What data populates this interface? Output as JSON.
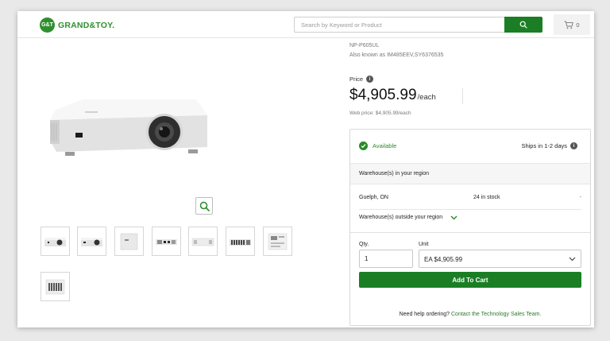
{
  "header": {
    "logo_badge": "G&T",
    "logo_text": "GRAND&TOY.",
    "search_placeholder": "Search by Keyword or Product",
    "cart_count": "0"
  },
  "product": {
    "sku": "NP-P605UL",
    "also_known": "Also known as IM485EEV,SY6376535",
    "price_label": "Price",
    "price": "$4,905.99",
    "per_unit": "/each",
    "web_price": "Web price: $4,905.99/each",
    "thumbnail_count": 8
  },
  "availability": {
    "status": "Available",
    "ships": "Ships in 1-2 days",
    "region_heading": "Warehouse(s) in your region",
    "warehouse": {
      "city": "Guelph, ON",
      "stock": "24 in stock",
      "extra": "-"
    },
    "outside_label": "Warehouse(s) outside your region"
  },
  "order": {
    "qty_label": "Qty.",
    "qty_value": "1",
    "unit_label": "Unit",
    "unit_value": "EA $4,905.99",
    "add_to_cart": "Add To Cart",
    "help_text": "Need help ordering?",
    "help_link": "Contact the Technology Sales Team."
  },
  "colors": {
    "brand_green": "#1b7e25",
    "available_green": "#2a8a2a"
  },
  "icons": [
    "search-icon",
    "cart-icon",
    "zoom-icon",
    "check-icon",
    "info-icon",
    "chevron-down-icon"
  ]
}
